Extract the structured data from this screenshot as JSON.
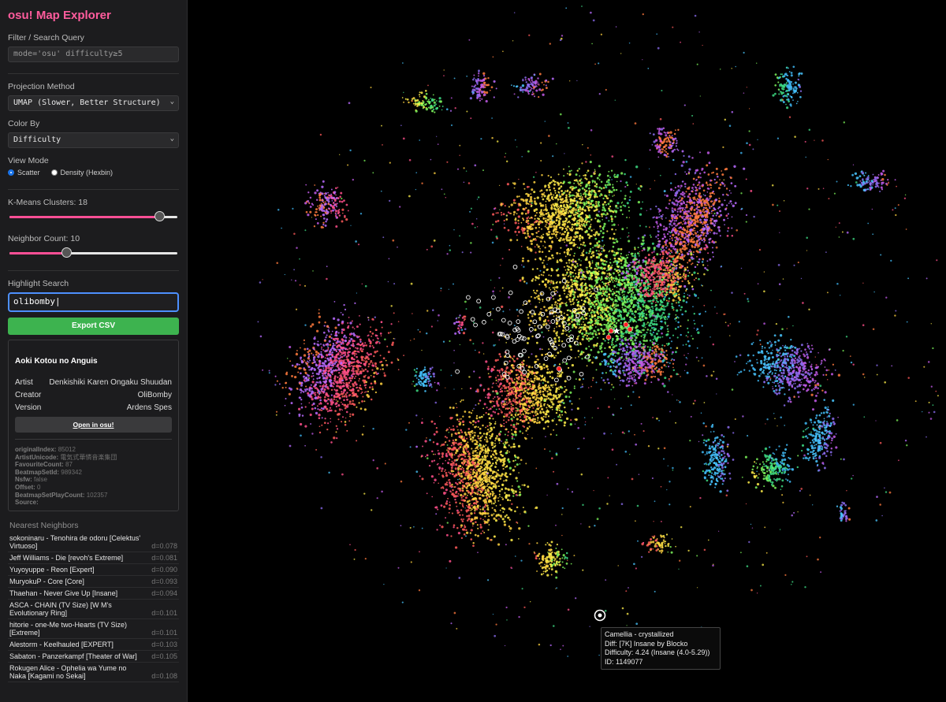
{
  "app": {
    "title": "osu! Map Explorer"
  },
  "filter": {
    "label": "Filter / Search Query",
    "value": "mode='osu' difficulty≥5"
  },
  "projection": {
    "label": "Projection Method",
    "value": "UMAP (Slower, Better Structure)"
  },
  "color_by": {
    "label": "Color By",
    "value": "Difficulty"
  },
  "view_mode": {
    "label": "View Mode",
    "options": [
      "Scatter",
      "Density (Hexbin)"
    ],
    "selected": "Scatter"
  },
  "kmeans": {
    "label": "K-Means Clusters: 18",
    "fraction": 0.9
  },
  "neighbors": {
    "label": "Neighbor Count: 10",
    "fraction": 0.34
  },
  "highlight": {
    "label": "Highlight Search",
    "value": "olibomby"
  },
  "export_label": "Export CSV",
  "details": {
    "title": "Aoki Kotou no Anguis",
    "rows": [
      {
        "k": "Artist",
        "v": "Denkishiki Karen Ongaku Shuudan"
      },
      {
        "k": "Creator",
        "v": "OliBomby"
      },
      {
        "k": "Version",
        "v": "Ardens Spes"
      }
    ],
    "open_label": "Open in osu!",
    "meta": [
      {
        "k": "originalIndex:",
        "v": "85012"
      },
      {
        "k": "ArtistUnicode:",
        "v": "電気式華憐音楽集団"
      },
      {
        "k": "FavouriteCount:",
        "v": "87"
      },
      {
        "k": "BeatmapSetId:",
        "v": "989342"
      },
      {
        "k": "Nsfw:",
        "v": "false"
      },
      {
        "k": "Offset:",
        "v": "0"
      },
      {
        "k": "BeatmapSetPlayCount:",
        "v": "102357"
      },
      {
        "k": "Source:",
        "v": ""
      }
    ]
  },
  "nearest": {
    "heading": "Nearest Neighbors",
    "items": [
      {
        "name": "sokoninaru - Tenohira de odoru [Celektus' Virtuoso]",
        "d": "d=0.078"
      },
      {
        "name": "Jeff Williams - Die [revoh's Extreme]",
        "d": "d=0.081"
      },
      {
        "name": "Yuyoyuppe - Reon [Expert]",
        "d": "d=0.090"
      },
      {
        "name": "MuryokuP - Core [Core]",
        "d": "d=0.093"
      },
      {
        "name": "Thaehan - Never Give Up [Insane]",
        "d": "d=0.094"
      },
      {
        "name": "ASCA - CHAIN (TV Size) [W M's Evolutionary Ring]",
        "d": "d=0.101"
      },
      {
        "name": "hitorie - one-Me two-Hearts (TV Size) [Extreme]",
        "d": "d=0.101"
      },
      {
        "name": "Alestorm - Keelhauled [EXPERT]",
        "d": "d=0.103"
      },
      {
        "name": "Sabaton - Panzerkampf [Theater of War]",
        "d": "d=0.105"
      },
      {
        "name": "Rokugen Alice - Ophelia wa Yume no Naka [Kagami no Sekai]",
        "d": "d=0.108"
      }
    ]
  },
  "tooltip": {
    "lines": [
      "Camellia - crystallized",
      "Diff: [7K] Insane by Blocko",
      "Difficulty: 4.24 (Insane (4.0-5.29))",
      "ID: 1149077"
    ]
  },
  "colors": {
    "accent": "#ff5c9d",
    "export_green": "#3db34f",
    "focus_blue": "#4d90fe",
    "highlight_red": "#ff2020"
  }
}
